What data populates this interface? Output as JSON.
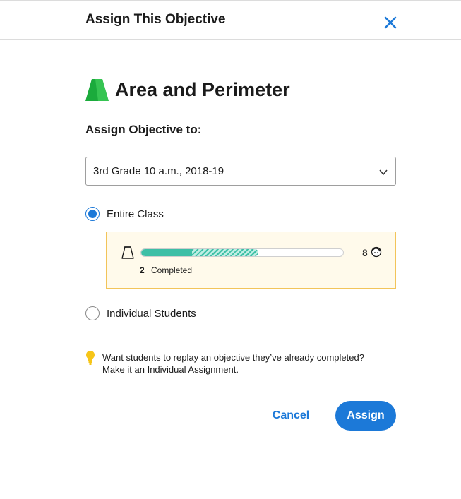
{
  "header": {
    "title": "Assign This Objective",
    "close_icon": "close-icon",
    "accent_color": "#1c79d8"
  },
  "objective": {
    "icon": "area-objective-icon",
    "icon_color": "#1bab3c",
    "title": "Area and Perimeter"
  },
  "assign_to": {
    "label": "Assign Objective to:"
  },
  "class_select": {
    "value": "3rd Grade 10 a.m., 2018-19",
    "icon": "chevron-down-icon"
  },
  "options": {
    "entire_class": {
      "label": "Entire Class",
      "selected": true
    },
    "individual_students": {
      "label": "Individual Students",
      "selected": false
    }
  },
  "progress": {
    "icon": "flask-icon",
    "completed_count": "2",
    "completed_label": "Completed",
    "student_count": "8",
    "student_icon": "student-face-icon",
    "completed_fraction": 0.25,
    "in_progress_fraction": 0.33,
    "box_border_color": "#f2c45a",
    "box_background": "#fffaeb",
    "bar_color": "#3dbfa6"
  },
  "tip": {
    "icon": "lightbulb-icon",
    "icon_color": "#f6c518",
    "line1": "Want students to replay an objective they’ve already completed?",
    "line2": "Make it an Individual Assignment."
  },
  "actions": {
    "cancel_label": "Cancel",
    "assign_label": "Assign"
  }
}
